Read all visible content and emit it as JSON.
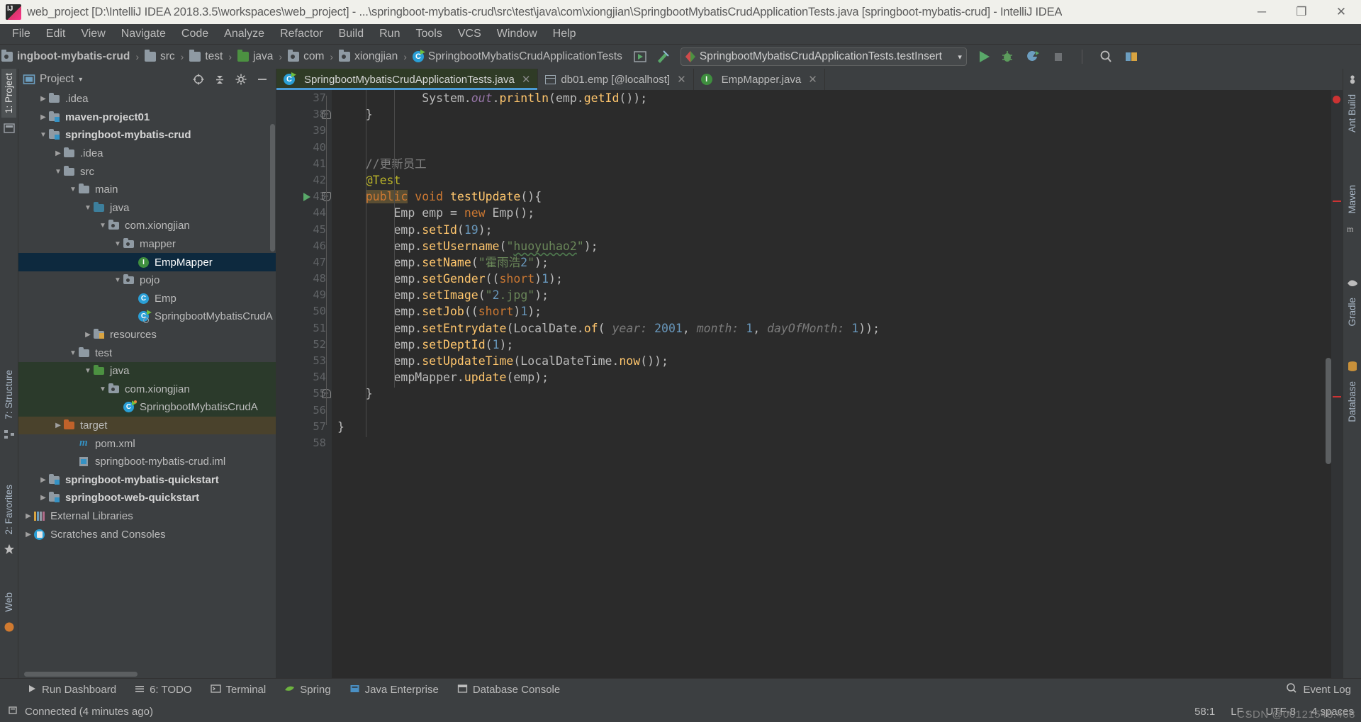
{
  "window": {
    "title": "web_project [D:\\IntelliJ IDEA 2018.3.5\\workspaces\\web_project] - ...\\springboot-mybatis-crud\\src\\test\\java\\com\\xiongjian\\SpringbootMybatisCrudApplicationTests.java [springboot-mybatis-crud] - IntelliJ IDEA",
    "minimize": "─",
    "maximize": "❐",
    "close": "✕"
  },
  "menubar": {
    "items": [
      {
        "label": "File"
      },
      {
        "label": "Edit"
      },
      {
        "label": "View"
      },
      {
        "label": "Navigate"
      },
      {
        "label": "Code"
      },
      {
        "label": "Analyze"
      },
      {
        "label": "Refactor"
      },
      {
        "label": "Build"
      },
      {
        "label": "Run"
      },
      {
        "label": "Tools"
      },
      {
        "label": "VCS"
      },
      {
        "label": "Window"
      },
      {
        "label": "Help"
      }
    ]
  },
  "navbar": {
    "breadcrumbs": [
      {
        "label": "ingboot-mybatis-crud",
        "icon": "module-icon",
        "bold": true
      },
      {
        "label": "src",
        "icon": "folder-icon"
      },
      {
        "label": "test",
        "icon": "folder-icon"
      },
      {
        "label": "java",
        "icon": "folder-green-icon"
      },
      {
        "label": "com",
        "icon": "package-icon"
      },
      {
        "label": "xiongjian",
        "icon": "package-icon"
      },
      {
        "label": "SpringbootMybatisCrudApplicationTests",
        "icon": "class-test-icon"
      }
    ],
    "separator": "›",
    "run_configuration": "SpringbootMybatisCrudApplicationTests.testInsert",
    "run_config_caret": "▾"
  },
  "project_panel": {
    "title": "Project",
    "caret": "▾",
    "tree": [
      {
        "label": ".idea",
        "indent": 1,
        "arrow": "right",
        "icon": "folder-icon",
        "state": "partial-top"
      },
      {
        "label": "maven-project01",
        "indent": 1,
        "arrow": "right",
        "icon": "module-icon",
        "bold": true
      },
      {
        "label": "springboot-mybatis-crud",
        "indent": 1,
        "arrow": "down",
        "icon": "module-icon",
        "bold": true
      },
      {
        "label": ".idea",
        "indent": 2,
        "arrow": "right",
        "icon": "folder-icon"
      },
      {
        "label": "src",
        "indent": 2,
        "arrow": "down",
        "icon": "folder-icon"
      },
      {
        "label": "main",
        "indent": 3,
        "arrow": "down",
        "icon": "folder-icon"
      },
      {
        "label": "java",
        "indent": 4,
        "arrow": "down",
        "icon": "folder-source-icon"
      },
      {
        "label": "com.xiongjian",
        "indent": 5,
        "arrow": "down",
        "icon": "package-icon"
      },
      {
        "label": "mapper",
        "indent": 6,
        "arrow": "down",
        "icon": "package-icon"
      },
      {
        "label": "EmpMapper",
        "indent": 7,
        "arrow": "none",
        "icon": "interface-icon",
        "selected": true
      },
      {
        "label": "pojo",
        "indent": 6,
        "arrow": "down",
        "icon": "package-icon"
      },
      {
        "label": "Emp",
        "indent": 7,
        "arrow": "none",
        "icon": "class-icon"
      },
      {
        "label": "SpringbootMybatisCrudA",
        "indent": 7,
        "arrow": "none",
        "icon": "class-run-icon"
      },
      {
        "label": "resources",
        "indent": 4,
        "arrow": "right",
        "icon": "folder-resources-icon"
      },
      {
        "label": "test",
        "indent": 3,
        "arrow": "down",
        "icon": "folder-icon"
      },
      {
        "label": "java",
        "indent": 4,
        "arrow": "down",
        "icon": "folder-test-icon",
        "rowclass": "testsrc"
      },
      {
        "label": "com.xiongjian",
        "indent": 5,
        "arrow": "down",
        "icon": "package-icon",
        "rowclass": "testsrc"
      },
      {
        "label": "SpringbootMybatisCrudA",
        "indent": 6,
        "arrow": "none",
        "icon": "class-test-icon",
        "rowclass": "testsrc"
      },
      {
        "label": "target",
        "indent": 2,
        "arrow": "right",
        "icon": "folder-excluded-icon",
        "rowclass": "excluded"
      },
      {
        "label": "pom.xml",
        "indent": 3,
        "arrow": "none",
        "icon": "maven-icon"
      },
      {
        "label": "springboot-mybatis-crud.iml",
        "indent": 3,
        "arrow": "none",
        "icon": "iml-icon"
      },
      {
        "label": "springboot-mybatis-quickstart",
        "indent": 1,
        "arrow": "right",
        "icon": "module-icon",
        "bold": true
      },
      {
        "label": "springboot-web-quickstart",
        "indent": 1,
        "arrow": "right",
        "icon": "module-icon",
        "bold": true
      },
      {
        "label": "External Libraries",
        "indent": 0,
        "arrow": "right",
        "icon": "libraries-icon"
      },
      {
        "label": "Scratches and Consoles",
        "indent": 0,
        "arrow": "right",
        "icon": "scratches-icon"
      }
    ]
  },
  "left_strip": {
    "tabs": [
      {
        "label": "1: Project",
        "active": true
      },
      {
        "label": "7: Structure",
        "active": false
      },
      {
        "label": "2: Favorites",
        "active": false
      },
      {
        "label": "Web",
        "active": false
      }
    ]
  },
  "right_strip": {
    "tabs": [
      {
        "label": "Ant Build"
      },
      {
        "label": "Maven"
      },
      {
        "label": "Gradle"
      },
      {
        "label": "Database"
      }
    ]
  },
  "editor": {
    "tabs": [
      {
        "label": "SpringbootMybatisCrudApplicationTests.java",
        "icon": "class-test-icon",
        "active": true,
        "close": "✕"
      },
      {
        "label": "db01.emp [@localhost]",
        "icon": "table-icon",
        "active": false,
        "close": "✕"
      },
      {
        "label": "EmpMapper.java",
        "icon": "interface-icon",
        "active": false,
        "close": "✕"
      }
    ],
    "first_line_number": 37,
    "lines": [
      {
        "n": 37,
        "text": "            System.out.println(emp.getId());"
      },
      {
        "n": 38,
        "text": "    }",
        "fold": "end"
      },
      {
        "n": 39,
        "text": ""
      },
      {
        "n": 40,
        "text": ""
      },
      {
        "n": 41,
        "text": "    //更新员工"
      },
      {
        "n": 42,
        "text": "    @Test"
      },
      {
        "n": 43,
        "text": "    public void testUpdate(){",
        "gutter_run": true,
        "fold": "start"
      },
      {
        "n": 44,
        "text": "        Emp emp = new Emp();"
      },
      {
        "n": 45,
        "text": "        emp.setId(19);"
      },
      {
        "n": 46,
        "text": "        emp.setUsername(\"huoyuhao2\");"
      },
      {
        "n": 47,
        "text": "        emp.setName(\"霍雨浩2\");"
      },
      {
        "n": 48,
        "text": "        emp.setGender((short)1);"
      },
      {
        "n": 49,
        "text": "        emp.setImage(\"2.jpg\");"
      },
      {
        "n": 50,
        "text": "        emp.setJob((short)1);"
      },
      {
        "n": 51,
        "text": "        emp.setEntrydate(LocalDate.of( year: 2001, month: 1, dayOfMonth: 1));"
      },
      {
        "n": 52,
        "text": "        emp.setDeptId(1);"
      },
      {
        "n": 53,
        "text": "        emp.setUpdateTime(LocalDateTime.now());"
      },
      {
        "n": 54,
        "text": "        empMapper.update(emp);"
      },
      {
        "n": 55,
        "text": "    }",
        "fold": "end"
      },
      {
        "n": 56,
        "text": ""
      },
      {
        "n": 57,
        "text": "}"
      },
      {
        "n": 58,
        "text": ""
      }
    ]
  },
  "bottom_bar": {
    "items": [
      {
        "label": "Run Dashboard",
        "icon": "run-icon"
      },
      {
        "label": "6: TODO",
        "icon": "todo-icon"
      },
      {
        "label": "Terminal",
        "icon": "terminal-icon"
      },
      {
        "label": "Spring",
        "icon": "spring-icon"
      },
      {
        "label": "Java Enterprise",
        "icon": "java-enterprise-icon"
      },
      {
        "label": "Database Console",
        "icon": "database-console-icon"
      }
    ],
    "event_log": "Event Log"
  },
  "status_bar": {
    "message": "Connected (4 minutes ago)",
    "caret_position": "58:1",
    "line_separator": "LF",
    "encoding": "UTF-8",
    "indent": "4 spaces",
    "lock_icon": "lock-icon",
    "watermark": "CSDN @00121548.468"
  },
  "colors": {
    "titlebar_bg": "#f0f0eb",
    "chrome_bg": "#3c3f41",
    "editor_bg": "#2b2b2b",
    "gutter_bg": "#313335",
    "selection_blue": "#0d293e",
    "test_source_green": "#2b3a2b",
    "excluded_brown": "#4a422c",
    "tab_underline": "#4a9bd5",
    "keyword": "#cc7832",
    "string": "#6a8759",
    "number": "#6897bb",
    "method": "#ffc66d",
    "comment": "#808080",
    "field": "#9876aa",
    "default_text": "#a9b7c6"
  }
}
